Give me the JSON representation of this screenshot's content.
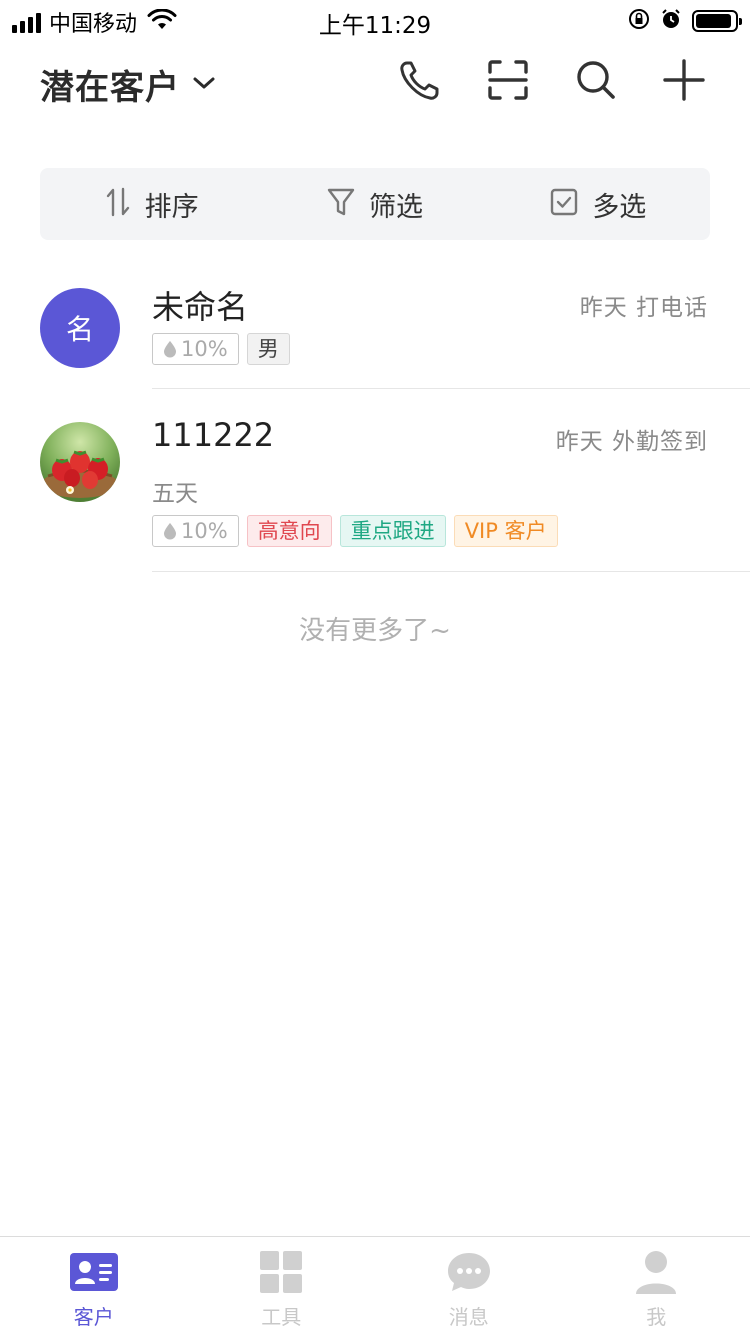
{
  "status_bar": {
    "carrier": "中国移动",
    "time": "上午11:29"
  },
  "header": {
    "title": "潜在客户",
    "icons": [
      "phone-icon",
      "scan-icon",
      "search-icon",
      "plus-icon"
    ]
  },
  "toolbar": {
    "sort_label": "排序",
    "filter_label": "筛选",
    "multiselect_label": "多选"
  },
  "customers": [
    {
      "avatar_text": "名",
      "name": "未命名",
      "meta": "昨天 打电话",
      "probability": "10%",
      "tags": [
        "男"
      ]
    },
    {
      "avatar_image": "strawberries",
      "name": "111222",
      "meta": "昨天 外勤签到",
      "subtitle": "五天",
      "probability": "10%",
      "tags": [
        "高意向",
        "重点跟进",
        "VIP 客户"
      ]
    }
  ],
  "list_end_text": "没有更多了~",
  "tabs": [
    {
      "label": "客户",
      "active": true
    },
    {
      "label": "工具",
      "active": false
    },
    {
      "label": "消息",
      "active": false
    },
    {
      "label": "我",
      "active": false
    }
  ],
  "colors": {
    "accent": "#5b57d6",
    "tag_red": "#e0474f",
    "tag_green": "#1fa883",
    "tag_orange": "#f08a24"
  }
}
